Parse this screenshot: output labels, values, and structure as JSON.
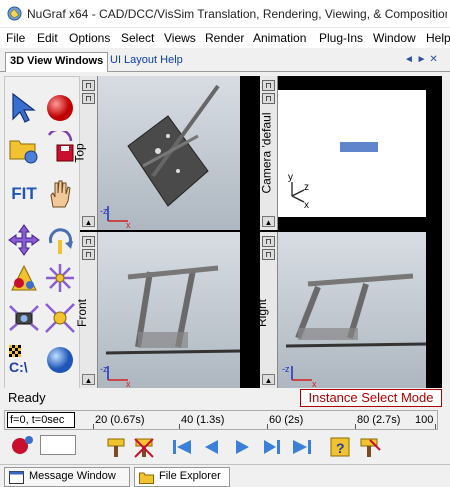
{
  "window": {
    "title": "NuGraf x64 - CAD/DCC/VisSim Translation, Rendering, Viewing, & Composition - San"
  },
  "menu": [
    "File",
    "Edit",
    "Options",
    "Select",
    "Views",
    "Render",
    "Animation",
    "Plug-Ins",
    "Window",
    "Help"
  ],
  "tabs": {
    "active": "3D View Windows",
    "other": "UI Layout Help",
    "nav": "◄ ► ✕"
  },
  "toolbar": {
    "fit_label": "FIT",
    "cl_label": "C:\\"
  },
  "viewports": {
    "top_label": "Top",
    "camera_label": "Camera 'defaul",
    "front_label": "Front",
    "right_label": "Right"
  },
  "status": {
    "ready": "Ready",
    "mode": "Instance Select Mode"
  },
  "timeline": {
    "readout": "f=0, t=0sec",
    "ticks": [
      "20 (0.67s)",
      "40 (1.3s)",
      "60 (2s)",
      "80 (2.7s)",
      "100"
    ]
  },
  "playback": {
    "frame_value": ""
  },
  "bottom_tabs": {
    "message": "Message Window",
    "explorer": "File Explorer"
  },
  "colors": {
    "status_mode": "#b00000",
    "link": "#0a3fa8"
  }
}
